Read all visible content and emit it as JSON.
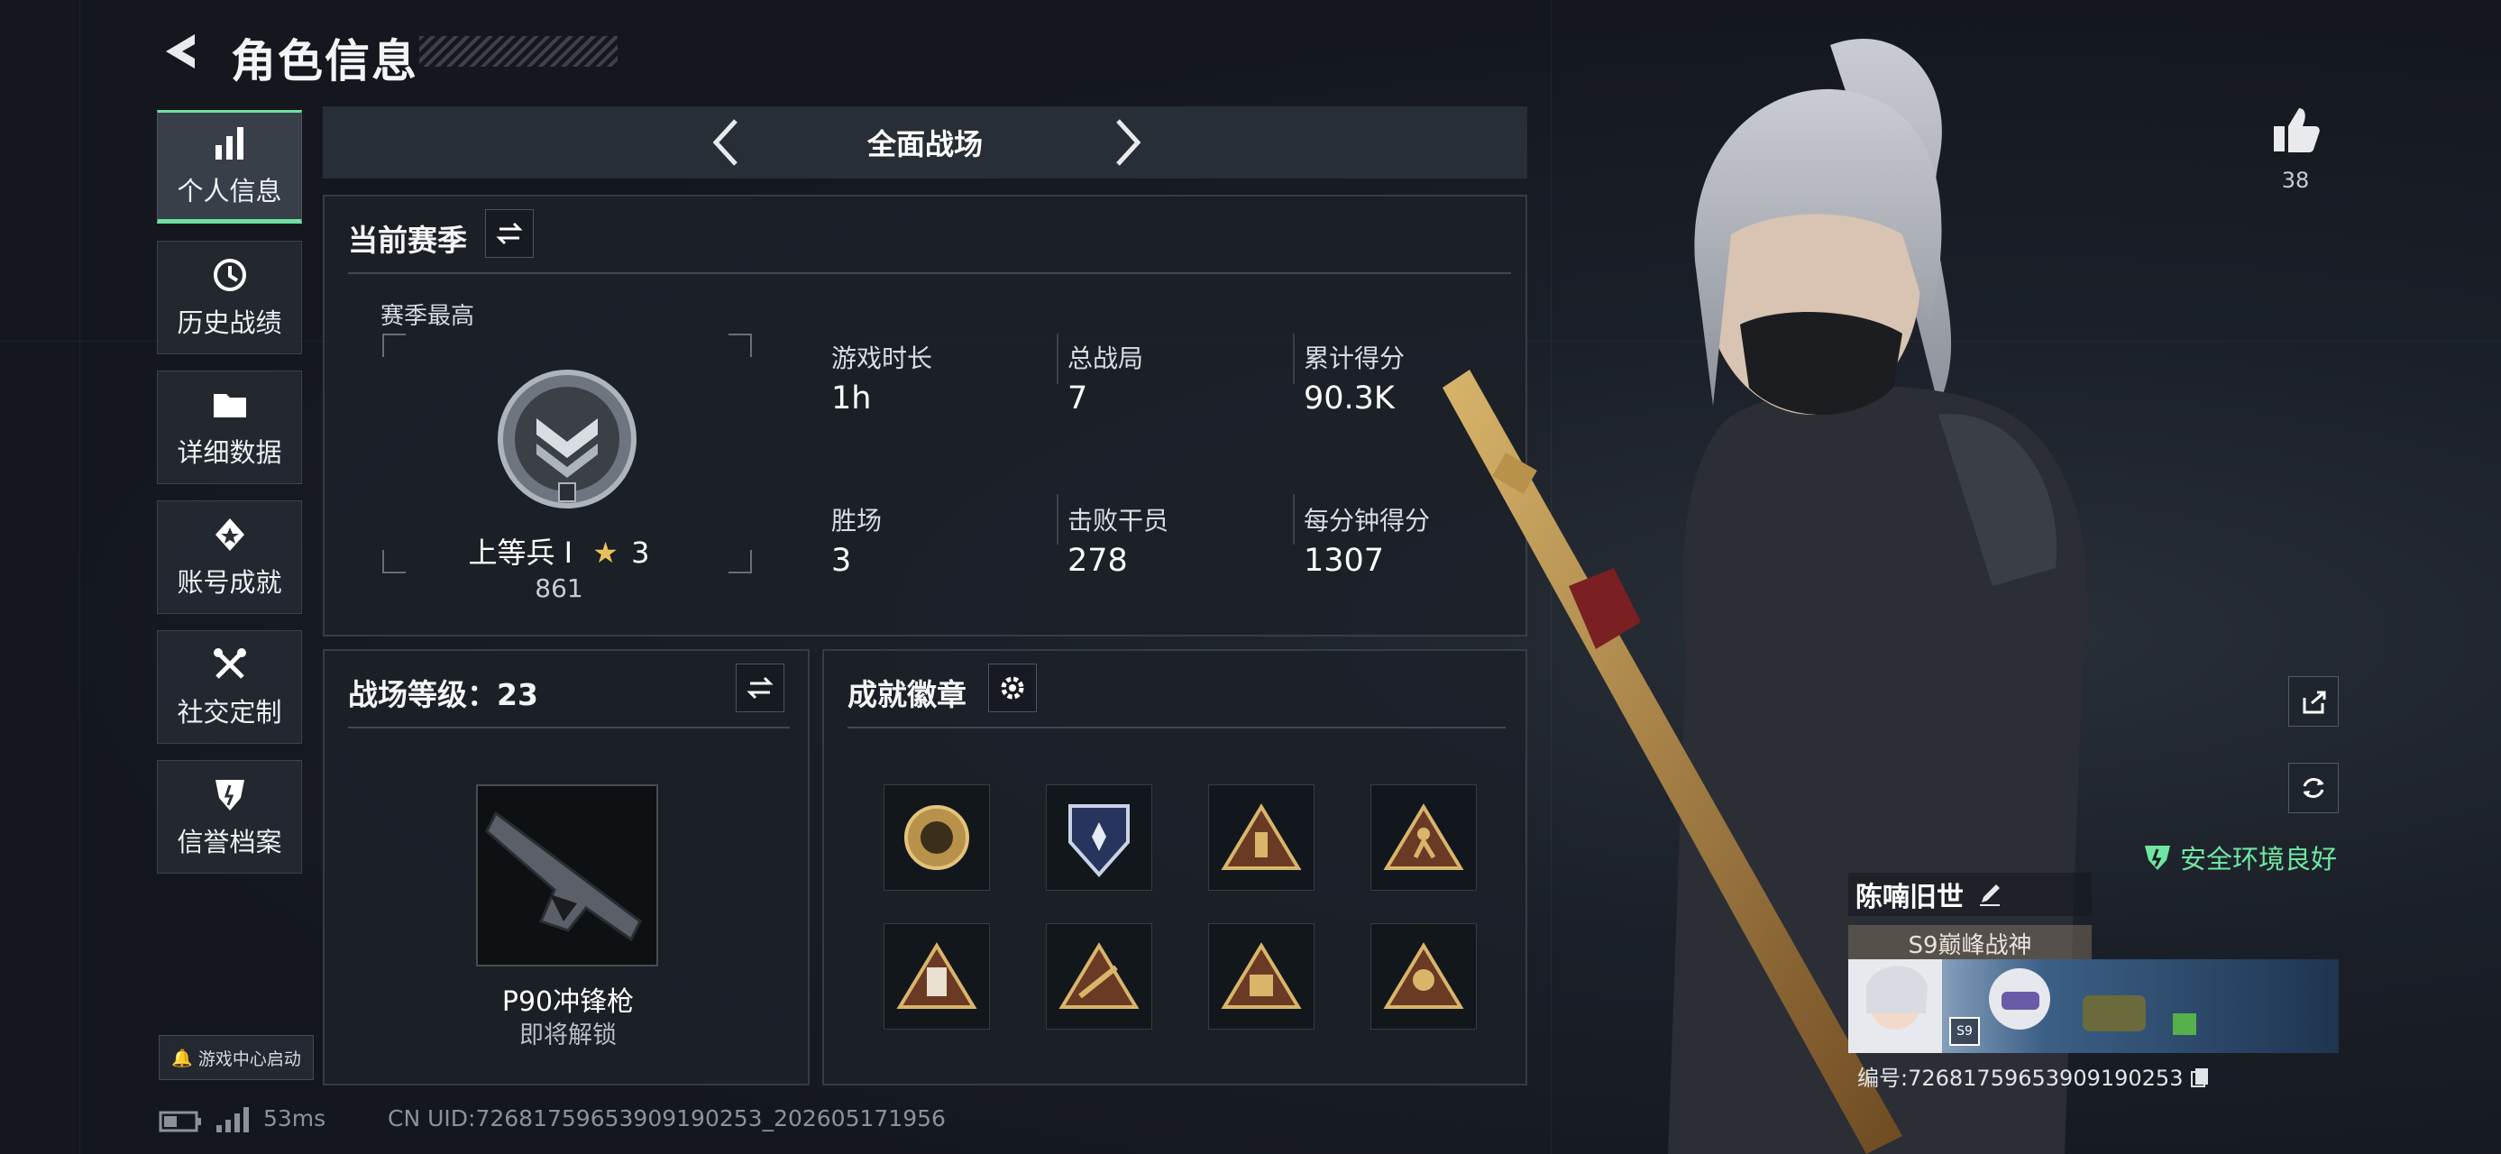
{
  "header": {
    "title": "角色信息"
  },
  "sidebar": {
    "items": [
      {
        "label": "个人信息"
      },
      {
        "label": "历史战绩"
      },
      {
        "label": "详细数据"
      },
      {
        "label": "账号成就"
      },
      {
        "label": "社交定制"
      },
      {
        "label": "信誉档案"
      }
    ],
    "launch_label": "游戏中心启动"
  },
  "mode_bar": {
    "mode": "全面战场"
  },
  "season": {
    "title": "当前赛季",
    "best_label": "赛季最高",
    "rank_name": "上等兵 Ⅰ",
    "rank_stars": "3",
    "rank_score": "861",
    "stats": [
      {
        "label": "游戏时长",
        "value": "1h"
      },
      {
        "label": "总战局",
        "value": "7"
      },
      {
        "label": "累计得分",
        "value": "90.3K"
      },
      {
        "label": "胜场",
        "value": "3"
      },
      {
        "label": "击败干员",
        "value": "278"
      },
      {
        "label": "每分钟得分",
        "value": "1307"
      }
    ]
  },
  "level_panel": {
    "title": "战场等级：23",
    "weapon_name": "P90冲锋枪",
    "weapon_status": "即将解锁"
  },
  "badges_panel": {
    "title": "成就徽章",
    "badges": [
      "coin-badge-icon",
      "shield-star-badge-icon",
      "triangle-badge-icon",
      "runner-triangle-badge-icon",
      "card-triangle-badge-icon",
      "rifle-triangle-badge-icon",
      "crate-triangle-badge-icon",
      "soldier-triangle-badge-icon"
    ]
  },
  "profile": {
    "likes": "38",
    "name": "陈喃旧世",
    "title_tag": "S9巅峰战神",
    "card_badge": "S9",
    "id_text": "编号:72681759653909190253",
    "security_status": "安全环境良好"
  },
  "status_bar": {
    "ping": "53ms",
    "uid": "CN UID:72681759653909190253_202605171956"
  },
  "colors": {
    "accent": "#6fe0a2",
    "background": "#15191f",
    "panel": "#1c2128"
  }
}
